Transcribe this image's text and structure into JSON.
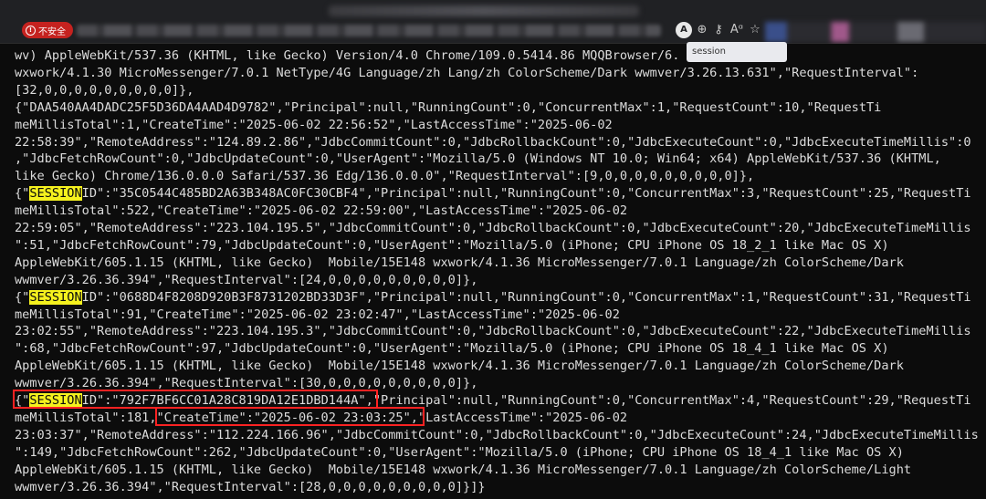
{
  "browser": {
    "security_label": "不安全",
    "translate_icon_label": "A",
    "find_text": "session"
  },
  "console": {
    "highlight_term": "SESSION",
    "lines": [
      [
        {
          "t": "wv) AppleWebKit/537.36 (KHTML, like Gecko) Version/4.0 Chrome/109.0.5414.86 MQQBrowser/6."
        }
      ],
      [
        {
          "t": "wxwork/4.1.30 MicroMessenger/7.0.1 NetType/4G Language/zh Lang/zh ColorScheme/Dark wwmver/3.26.13.631\",\"RequestInterval\":"
        }
      ],
      [
        {
          "t": "[32,0,0,0,0,0,0,0,0,0]},"
        }
      ],
      [
        {
          "t": "{\""
        },
        {
          "t": "DAA540AA4DADC25F5D36DA4AAD4D9782\",\"Principal\":null,\"RunningCount\":0,\"ConcurrentMax\":1,\"RequestCount\":10,\"RequestTi"
        }
      ],
      [
        {
          "t": "meMillisTotal\":1,\"CreateTime\":\"2025-06-02 22:56:52\",\"LastAccessTime\":\"2025-06-02"
        }
      ],
      [
        {
          "t": "22:58:39\",\"RemoteAddress\":\"124.89.2.86\",\"JdbcCommitCount\":0,\"JdbcRollbackCount\":0,\"JdbcExecuteCount\":0,\"JdbcExecuteTimeMillis\":0"
        }
      ],
      [
        {
          "t": ",\"JdbcFetchRowCount\":0,\"JdbcUpdateCount\":0,\"UserAgent\":\"Mozilla/5.0 (Windows NT 10.0; Win64; x64) AppleWebKit/537.36 (KHTML,"
        }
      ],
      [
        {
          "t": "like Gecko) Chrome/136.0.0.0 Safari/537.36 Edg/136.0.0.0\",\"RequestInterval\":[9,0,0,0,0,0,0,0,0,0]},"
        }
      ],
      [
        {
          "t": "{\""
        },
        {
          "t": "SESSION",
          "hl": true
        },
        {
          "t": "ID\":\"35C0544C485BD2A63B348AC0FC30CBF4\",\"Principal\":null,\"RunningCount\":0,\"ConcurrentMax\":3,\"RequestCount\":25,\"RequestTi"
        }
      ],
      [
        {
          "t": "meMillisTotal\":522,\"CreateTime\":\"2025-06-02 22:59:00\",\"LastAccessTime\":\"2025-06-02"
        }
      ],
      [
        {
          "t": "22:59:05\",\"RemoteAddress\":\"223.104.195.5\",\"JdbcCommitCount\":0,\"JdbcRollbackCount\":0,\"JdbcExecuteCount\":20,\"JdbcExecuteTimeMillis"
        }
      ],
      [
        {
          "t": "\":51,\"JdbcFetchRowCount\":79,\"JdbcUpdateCount\":0,\"UserAgent\":\"Mozilla/5.0 (iPhone; CPU iPhone OS 18_2_1 like Mac OS X)"
        }
      ],
      [
        {
          "t": "AppleWebKit/605.1.15 (KHTML, like Gecko)  Mobile/15E148 wxwork/4.1.36 MicroMessenger/7.0.1 Language/zh ColorScheme/Dark"
        }
      ],
      [
        {
          "t": "wwmver/3.26.36.394\",\"RequestInterval\":[24,0,0,0,0,0,0,0,0,0]},"
        }
      ],
      [
        {
          "t": "{\""
        },
        {
          "t": "SESSION",
          "hl": true
        },
        {
          "t": "ID\":\"0688D4F8208D920B3F8731202BD33D3F\",\"Principal\":null,\"RunningCount\":0,\"ConcurrentMax\":1,\"RequestCount\":31,\"RequestTi"
        }
      ],
      [
        {
          "t": "meMillisTotal\":91,\"CreateTime\":\"2025-06-02 23:02:47\",\"LastAccessTime\":\"2025-06-02"
        }
      ],
      [
        {
          "t": "23:02:55\",\"RemoteAddress\":\"223.104.195.3\",\"JdbcCommitCount\":0,\"JdbcRollbackCount\":0,\"JdbcExecuteCount\":22,\"JdbcExecuteTimeMillis"
        }
      ],
      [
        {
          "t": "\":68,\"JdbcFetchRowCount\":97,\"JdbcUpdateCount\":0,\"UserAgent\":\"Mozilla/5.0 (iPhone; CPU iPhone OS 18_4_1 like Mac OS X)"
        }
      ],
      [
        {
          "t": "AppleWebKit/605.1.15 (KHTML, like Gecko)  Mobile/15E148 wxwork/4.1.36 MicroMessenger/7.0.1 Language/zh ColorScheme/Dark"
        }
      ],
      [
        {
          "t": "wwmver/3.26.36.394\",\"RequestInterval\":[30,0,0,0,0,0,0,0,0,0]},"
        }
      ],
      [
        {
          "t": "{\""
        },
        {
          "t": "SESSION",
          "hl": true
        },
        {
          "t": "ID\":\"792F7BF6CC01A28C819DA12E1DBD144A\",\"Principal\":null,\"RunningCount\":0,\"ConcurrentMax\":4,\"RequestCount\":29,\"RequestTi"
        }
      ],
      [
        {
          "t": "meMillisTotal\":181,\"CreateTime\":\"2025-06-02 23:03:25\",\"LastAccessTime\":\"2025-06-02"
        }
      ],
      [
        {
          "t": "23:03:37\",\"RemoteAddress\":\"112.224.166.96\",\"JdbcCommitCount\":0,\"JdbcRollbackCount\":0,\"JdbcExecuteCount\":24,\"JdbcExecuteTimeMillis"
        }
      ],
      [
        {
          "t": "\":149,\"JdbcFetchRowCount\":262,\"JdbcUpdateCount\":0,\"UserAgent\":\"Mozilla/5.0 (iPhone; CPU iPhone OS 18_4_1 like Mac OS X)"
        }
      ],
      [
        {
          "t": "AppleWebKit/605.1.15 (KHTML, like Gecko)  Mobile/15E148 wxwork/4.1.36 MicroMessenger/7.0.1 Language/zh ColorScheme/Light"
        }
      ],
      [
        {
          "t": "wwmver/3.26.36.394\",\"RequestInterval\":[28,0,0,0,0,0,0,0,0,0]}]}"
        }
      ]
    ]
  }
}
